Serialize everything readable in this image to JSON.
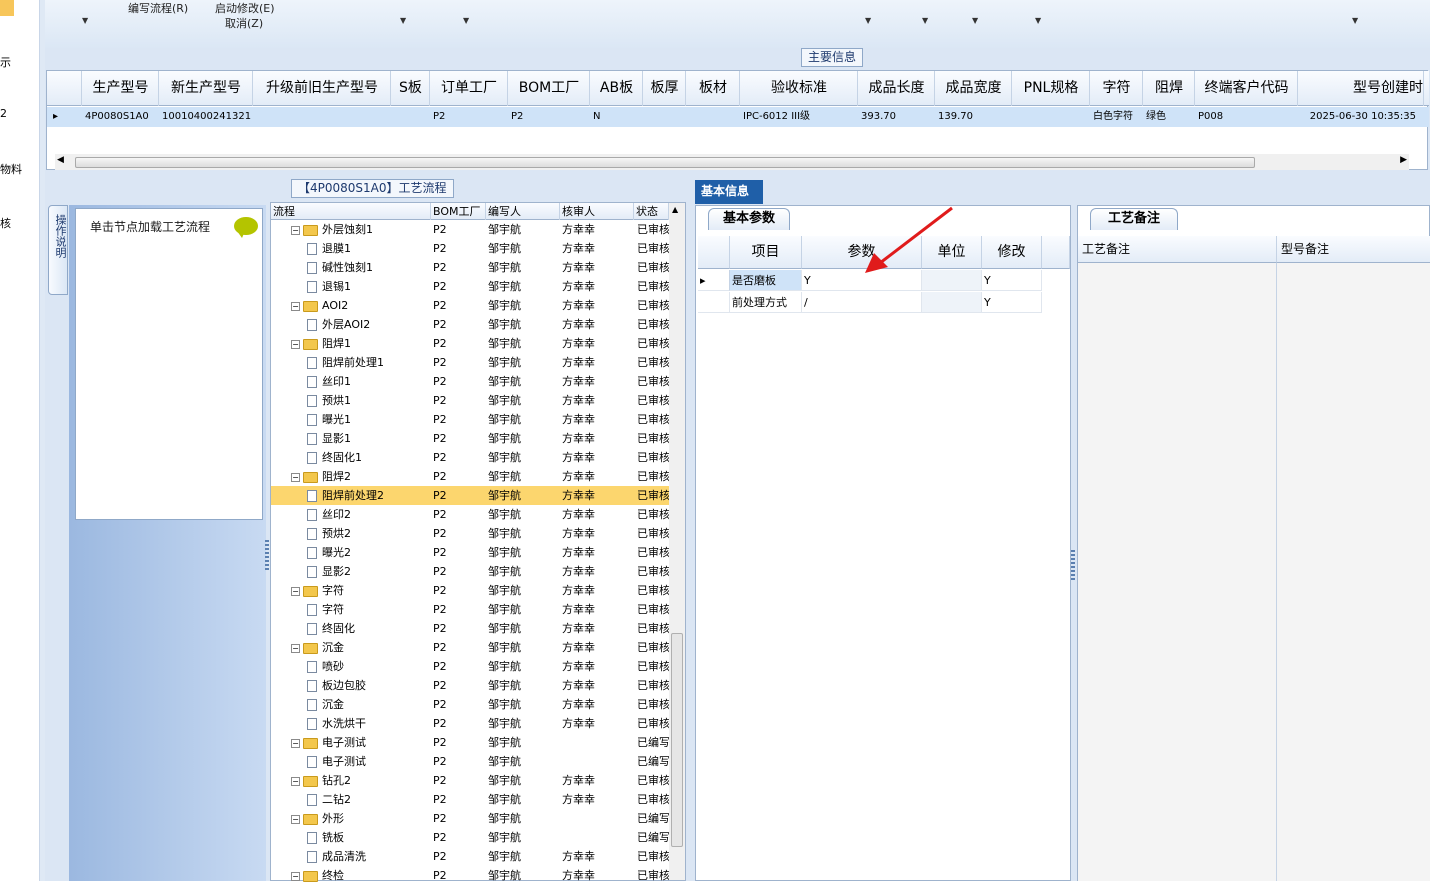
{
  "left_nav": [
    "示",
    "2",
    "物料",
    "核"
  ],
  "ribbon": {
    "btn_workflow": "编写流程(R)",
    "btn_startmod": "启动修改(E)",
    "btn_cancel": "取消(Z)"
  },
  "main_info": {
    "caption": "主要信息",
    "columns": [
      "生产型号",
      "新生产型号",
      "升级前旧生产型号",
      "S板",
      "订单工厂",
      "BOM工厂",
      "AB板",
      "板厚",
      "板材",
      "验收标准",
      "成品长度",
      "成品宽度",
      "PNL规格",
      "字符",
      "阻焊",
      "终端客户代码",
      "型号创建时"
    ],
    "row": [
      "4P0080S1A0",
      "10010400241321",
      "",
      "",
      "P2",
      "P2",
      "N",
      "",
      "",
      "IPC-6012 III级",
      "393.70",
      "139.70",
      "",
      "白色字符",
      "绿色",
      "P008",
      "2025-06-30 10:35:35"
    ]
  },
  "flow": {
    "caption": "【4P0080S1A0】工艺流程",
    "side_tab": "操作说明",
    "hint": "单击节点加载工艺流程",
    "columns": [
      "流程",
      "BOM工厂",
      "编写人",
      "核审人",
      "状态"
    ],
    "rows": [
      {
        "name": "外层蚀刻1",
        "level": 0,
        "bom": "P2",
        "writer": "邹宇航",
        "checker": "方幸幸",
        "status": "已审核"
      },
      {
        "name": "退膜1",
        "level": 1,
        "bom": "P2",
        "writer": "邹宇航",
        "checker": "方幸幸",
        "status": "已审核"
      },
      {
        "name": "碱性蚀刻1",
        "level": 1,
        "bom": "P2",
        "writer": "邹宇航",
        "checker": "方幸幸",
        "status": "已审核"
      },
      {
        "name": "退锡1",
        "level": 1,
        "bom": "P2",
        "writer": "邹宇航",
        "checker": "方幸幸",
        "status": "已审核"
      },
      {
        "name": "AOI2",
        "level": 0,
        "bom": "P2",
        "writer": "邹宇航",
        "checker": "方幸幸",
        "status": "已审核"
      },
      {
        "name": "外层AOI2",
        "level": 1,
        "bom": "P2",
        "writer": "邹宇航",
        "checker": "方幸幸",
        "status": "已审核"
      },
      {
        "name": "阻焊1",
        "level": 0,
        "bom": "P2",
        "writer": "邹宇航",
        "checker": "方幸幸",
        "status": "已审核"
      },
      {
        "name": "阻焊前处理1",
        "level": 1,
        "bom": "P2",
        "writer": "邹宇航",
        "checker": "方幸幸",
        "status": "已审核"
      },
      {
        "name": "丝印1",
        "level": 1,
        "bom": "P2",
        "writer": "邹宇航",
        "checker": "方幸幸",
        "status": "已审核"
      },
      {
        "name": "预烘1",
        "level": 1,
        "bom": "P2",
        "writer": "邹宇航",
        "checker": "方幸幸",
        "status": "已审核"
      },
      {
        "name": "曝光1",
        "level": 1,
        "bom": "P2",
        "writer": "邹宇航",
        "checker": "方幸幸",
        "status": "已审核"
      },
      {
        "name": "显影1",
        "level": 1,
        "bom": "P2",
        "writer": "邹宇航",
        "checker": "方幸幸",
        "status": "已审核"
      },
      {
        "name": "终固化1",
        "level": 1,
        "bom": "P2",
        "writer": "邹宇航",
        "checker": "方幸幸",
        "status": "已审核"
      },
      {
        "name": "阻焊2",
        "level": 0,
        "bom": "P2",
        "writer": "邹宇航",
        "checker": "方幸幸",
        "status": "已审核"
      },
      {
        "name": "阻焊前处理2",
        "level": 1,
        "bom": "P2",
        "writer": "邹宇航",
        "checker": "方幸幸",
        "status": "已审核",
        "selected": true
      },
      {
        "name": "丝印2",
        "level": 1,
        "bom": "P2",
        "writer": "邹宇航",
        "checker": "方幸幸",
        "status": "已审核"
      },
      {
        "name": "预烘2",
        "level": 1,
        "bom": "P2",
        "writer": "邹宇航",
        "checker": "方幸幸",
        "status": "已审核"
      },
      {
        "name": "曝光2",
        "level": 1,
        "bom": "P2",
        "writer": "邹宇航",
        "checker": "方幸幸",
        "status": "已审核"
      },
      {
        "name": "显影2",
        "level": 1,
        "bom": "P2",
        "writer": "邹宇航",
        "checker": "方幸幸",
        "status": "已审核"
      },
      {
        "name": "字符",
        "level": 0,
        "bom": "P2",
        "writer": "邹宇航",
        "checker": "方幸幸",
        "status": "已审核"
      },
      {
        "name": "字符",
        "level": 1,
        "bom": "P2",
        "writer": "邹宇航",
        "checker": "方幸幸",
        "status": "已审核"
      },
      {
        "name": "终固化",
        "level": 1,
        "bom": "P2",
        "writer": "邹宇航",
        "checker": "方幸幸",
        "status": "已审核"
      },
      {
        "name": "沉金",
        "level": 0,
        "bom": "P2",
        "writer": "邹宇航",
        "checker": "方幸幸",
        "status": "已审核"
      },
      {
        "name": "喷砂",
        "level": 1,
        "bom": "P2",
        "writer": "邹宇航",
        "checker": "方幸幸",
        "status": "已审核"
      },
      {
        "name": "板边包胶",
        "level": 1,
        "bom": "P2",
        "writer": "邹宇航",
        "checker": "方幸幸",
        "status": "已审核"
      },
      {
        "name": "沉金",
        "level": 1,
        "bom": "P2",
        "writer": "邹宇航",
        "checker": "方幸幸",
        "status": "已审核"
      },
      {
        "name": "水洗烘干",
        "level": 1,
        "bom": "P2",
        "writer": "邹宇航",
        "checker": "方幸幸",
        "status": "已审核"
      },
      {
        "name": "电子测试",
        "level": 0,
        "bom": "P2",
        "writer": "邹宇航",
        "checker": "",
        "status": "已编写"
      },
      {
        "name": "电子测试",
        "level": 1,
        "bom": "P2",
        "writer": "邹宇航",
        "checker": "",
        "status": "已编写"
      },
      {
        "name": "钻孔2",
        "level": 0,
        "bom": "P2",
        "writer": "邹宇航",
        "checker": "方幸幸",
        "status": "已审核"
      },
      {
        "name": "二钻2",
        "level": 1,
        "bom": "P2",
        "writer": "邹宇航",
        "checker": "方幸幸",
        "status": "已审核"
      },
      {
        "name": "外形",
        "level": 0,
        "bom": "P2",
        "writer": "邹宇航",
        "checker": "",
        "status": "已编写"
      },
      {
        "name": "铣板",
        "level": 1,
        "bom": "P2",
        "writer": "邹宇航",
        "checker": "",
        "status": "已编写"
      },
      {
        "name": "成品清洗",
        "level": 1,
        "bom": "P2",
        "writer": "邹宇航",
        "checker": "方幸幸",
        "status": "已审核"
      },
      {
        "name": "终检",
        "level": 0,
        "bom": "P2",
        "writer": "邹宇航",
        "checker": "方幸幸",
        "status": "已审核"
      }
    ]
  },
  "basic": {
    "tab": "基本信息",
    "params_tab": "基本参数",
    "params_columns": [
      "项目",
      "参数",
      "单位",
      "修改"
    ],
    "params_rows": [
      {
        "item": "是否磨板",
        "param": "Y",
        "unit": "",
        "modify": "Y"
      },
      {
        "item": "前处理方式",
        "param": "/",
        "unit": "",
        "modify": "Y"
      }
    ],
    "notes_tab": "工艺备注",
    "notes_columns": [
      "工艺备注",
      "型号备注"
    ]
  },
  "colors": {
    "selection": "#fcd66e",
    "header_tab": "#1f5fa8",
    "annotation_arrow": "#e01b1b"
  }
}
